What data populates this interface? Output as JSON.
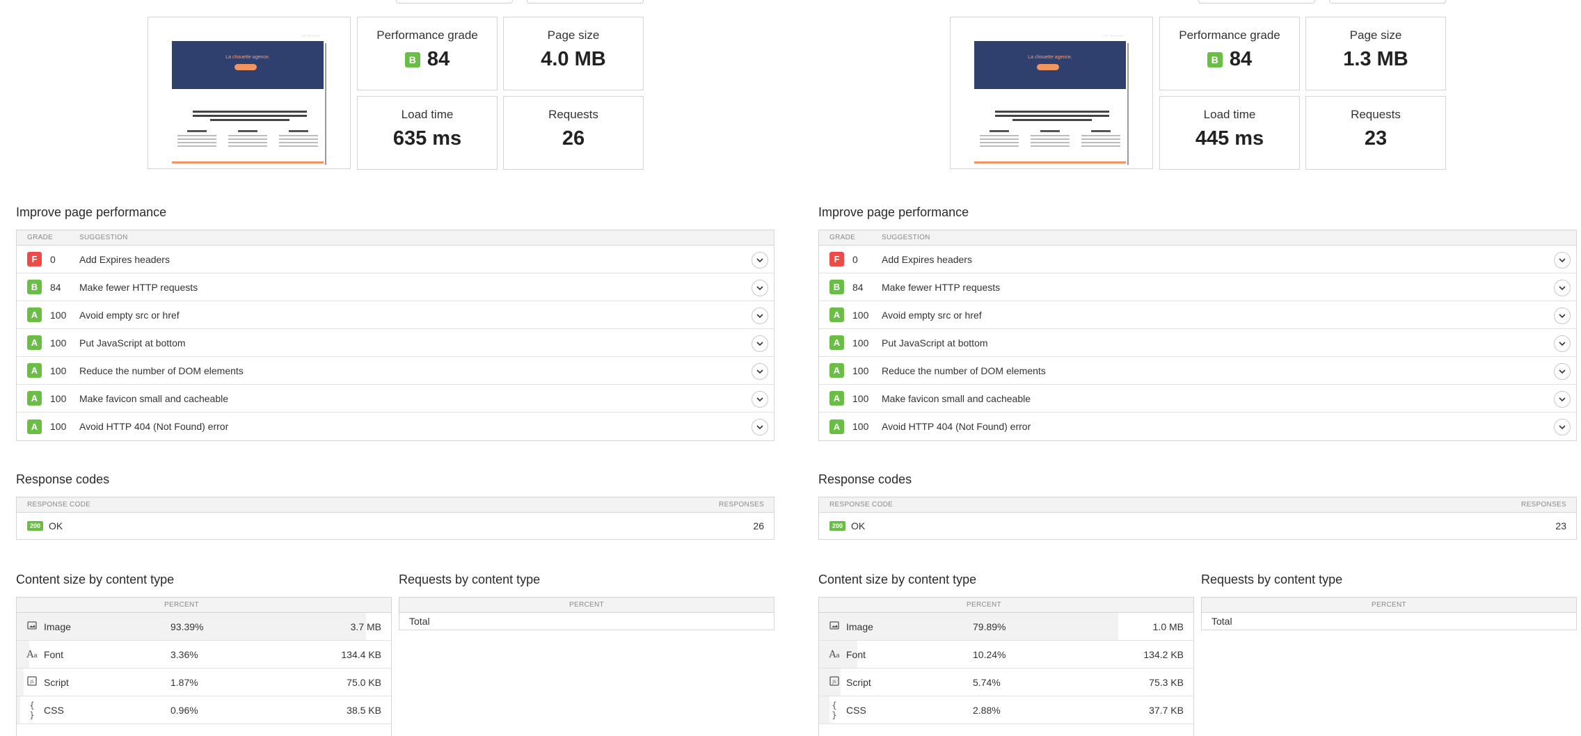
{
  "colors": {
    "grade_a": "#6abe45",
    "grade_b": "#6abe45",
    "grade_f": "#ee4a48",
    "hero": "#2f3f6e",
    "accent": "#f0955f"
  },
  "left": {
    "thumb": {
      "hero_title": "La chouette agence."
    },
    "metrics": {
      "grade_label": "Performance grade",
      "grade_letter": "B",
      "grade_value": "84",
      "size_label": "Page size",
      "size_value": "4.0 MB",
      "load_label": "Load time",
      "load_value": "635 ms",
      "req_label": "Requests",
      "req_value": "26"
    },
    "improve": {
      "title": "Improve page performance",
      "col_grade": "Grade",
      "col_suggestion": "Suggestion",
      "rows": [
        {
          "grade": "F",
          "score": "0",
          "text": "Add Expires headers"
        },
        {
          "grade": "B",
          "score": "84",
          "text": "Make fewer HTTP requests"
        },
        {
          "grade": "A",
          "score": "100",
          "text": "Avoid empty src or href"
        },
        {
          "grade": "A",
          "score": "100",
          "text": "Put JavaScript at bottom"
        },
        {
          "grade": "A",
          "score": "100",
          "text": "Reduce the number of DOM elements"
        },
        {
          "grade": "A",
          "score": "100",
          "text": "Make favicon small and cacheable"
        },
        {
          "grade": "A",
          "score": "100",
          "text": "Avoid HTTP 404 (Not Found) error"
        }
      ]
    },
    "response": {
      "title": "Response codes",
      "col_code": "Response code",
      "col_resp": "Responses",
      "code": "200",
      "label": "OK",
      "count": "26"
    },
    "content_size": {
      "title": "Content size by content type",
      "col_percent": "Percent",
      "rows": [
        {
          "icon": "image-icon",
          "name": "Image",
          "percent": "93.39%",
          "size": "3.7 MB",
          "fill": 0.9339
        },
        {
          "icon": "font-icon",
          "name": "Font",
          "percent": "3.36%",
          "size": "134.4 KB",
          "fill": 0.0336
        },
        {
          "icon": "script-icon",
          "name": "Script",
          "percent": "1.87%",
          "size": "75.0 KB",
          "fill": 0.0187
        },
        {
          "icon": "css-icon",
          "name": "CSS",
          "percent": "0.96%",
          "size": "38.5 KB",
          "fill": 0.0096
        }
      ]
    },
    "requests": {
      "title": "Requests by content type",
      "col_percent": "Percent",
      "total": "Total"
    }
  },
  "right": {
    "thumb": {
      "hero_title": "La chouette agence."
    },
    "metrics": {
      "grade_label": "Performance grade",
      "grade_letter": "B",
      "grade_value": "84",
      "size_label": "Page size",
      "size_value": "1.3 MB",
      "load_label": "Load time",
      "load_value": "445 ms",
      "req_label": "Requests",
      "req_value": "23"
    },
    "improve": {
      "title": "Improve page performance",
      "col_grade": "Grade",
      "col_suggestion": "Suggestion",
      "rows": [
        {
          "grade": "F",
          "score": "0",
          "text": "Add Expires headers"
        },
        {
          "grade": "B",
          "score": "84",
          "text": "Make fewer HTTP requests"
        },
        {
          "grade": "A",
          "score": "100",
          "text": "Avoid empty src or href"
        },
        {
          "grade": "A",
          "score": "100",
          "text": "Put JavaScript at bottom"
        },
        {
          "grade": "A",
          "score": "100",
          "text": "Reduce the number of DOM elements"
        },
        {
          "grade": "A",
          "score": "100",
          "text": "Make favicon small and cacheable"
        },
        {
          "grade": "A",
          "score": "100",
          "text": "Avoid HTTP 404 (Not Found) error"
        }
      ]
    },
    "response": {
      "title": "Response codes",
      "col_code": "Response code",
      "col_resp": "Responses",
      "code": "200",
      "label": "OK",
      "count": "23"
    },
    "content_size": {
      "title": "Content size by content type",
      "col_percent": "Percent",
      "rows": [
        {
          "icon": "image-icon",
          "name": "Image",
          "percent": "79.89%",
          "size": "1.0 MB",
          "fill": 0.7989
        },
        {
          "icon": "font-icon",
          "name": "Font",
          "percent": "10.24%",
          "size": "134.2 KB",
          "fill": 0.1024
        },
        {
          "icon": "script-icon",
          "name": "Script",
          "percent": "5.74%",
          "size": "75.3 KB",
          "fill": 0.0574
        },
        {
          "icon": "css-icon",
          "name": "CSS",
          "percent": "2.88%",
          "size": "37.7 KB",
          "fill": 0.0288
        }
      ]
    },
    "requests": {
      "title": "Requests by content type",
      "col_percent": "Percent",
      "total": "Total"
    }
  }
}
